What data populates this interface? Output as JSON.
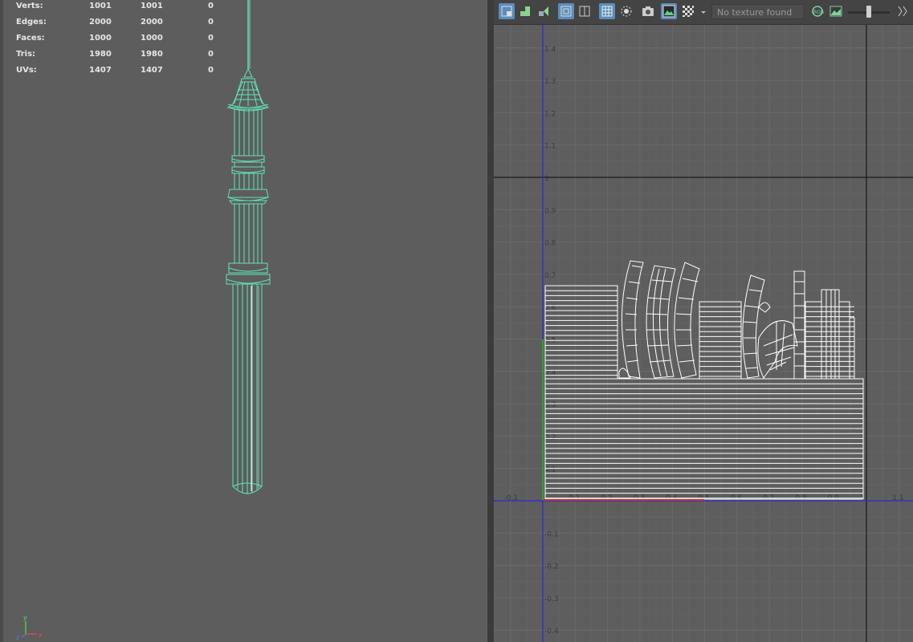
{
  "stats": [
    {
      "label": "Verts:",
      "v1": "1001",
      "v2": "1001",
      "v3": "0"
    },
    {
      "label": "Edges:",
      "v1": "2000",
      "v2": "2000",
      "v3": "0"
    },
    {
      "label": "Faces:",
      "v1": "1000",
      "v2": "1000",
      "v3": "0"
    },
    {
      "label": "Tris:",
      "v1": "1980",
      "v2": "1980",
      "v3": "0"
    },
    {
      "label": "UVs:",
      "v1": "1407",
      "v2": "1407",
      "v3": "0"
    }
  ],
  "uv_editor": {
    "texture_placeholder": "No texture found",
    "v_ticks": [
      "1.4",
      "1.3",
      "1.2",
      "1.1",
      "1",
      "0.9",
      "0.8",
      "0.7",
      "0.6",
      "0.5",
      "0.4",
      "0.3",
      "0.2",
      "0.1",
      "-0.1",
      "-0.2",
      "-0.3",
      "-0.4"
    ],
    "u_ticks": [
      "-0.1",
      "0.1",
      "0.2",
      "0.3",
      "0.4",
      "0.5",
      "0.6",
      "0.7",
      "0.8",
      "0.9",
      "1",
      "1.1"
    ],
    "exposure_level": 0.6
  },
  "toolbar_icons": [
    "uv-layout-icon",
    "uv-shell-icon",
    "uv-select-icon",
    "frame-all-icon",
    "frame-selected-icon",
    "grid-toggle-icon",
    "isolate-icon",
    "snapshot-icon",
    "image-display-icon",
    "checker-icon",
    "dropdown-arrow-icon",
    "rgb-channels-icon",
    "image-ratio-icon",
    "exposure-slider",
    "more-icon"
  ],
  "colors": {
    "wire": "#5fe5b5",
    "uv_line": "#ffffff",
    "axis_u": "#2a2ad6",
    "axis_v_line": "#1010a0"
  }
}
